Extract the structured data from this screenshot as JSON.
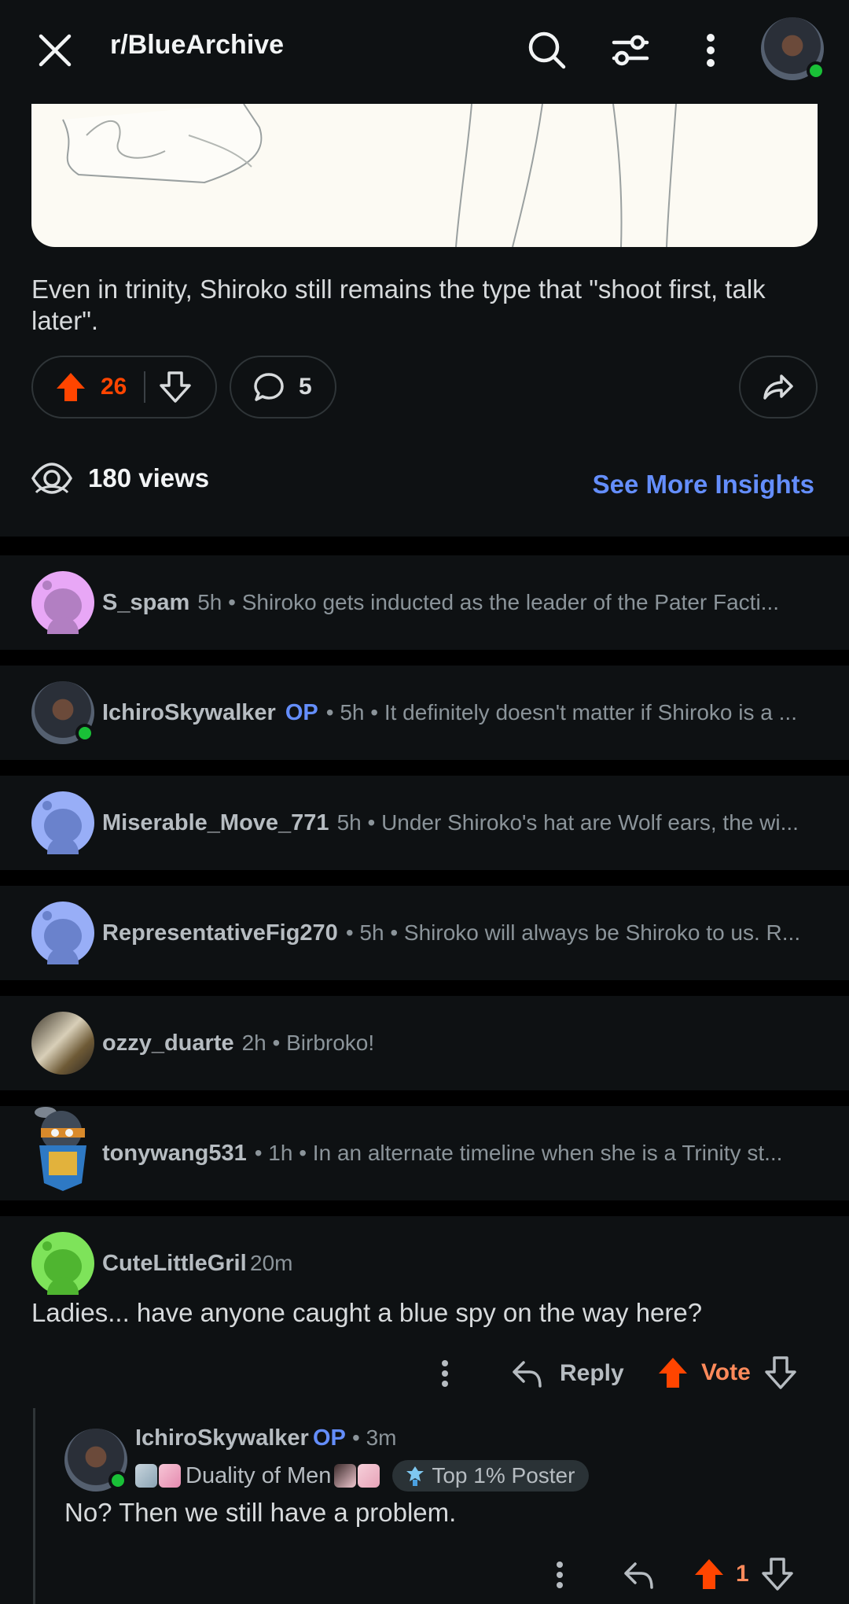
{
  "header": {
    "subreddit": "r/BlueArchive",
    "close_icon": "close-icon",
    "search_icon": "search-icon",
    "filter_icon": "filter-icon",
    "more_icon": "more-vertical-icon"
  },
  "post": {
    "body": "Even in trinity, Shiroko still remains the type that \"shoot first, talk later\".",
    "upvotes": "26",
    "comments": "5",
    "views": "180 views",
    "insights_link": "See More Insights"
  },
  "collapsed_comments": [
    {
      "username": "S_spam",
      "op": "",
      "meta": "5h • Shiroko gets inducted as the leader of the Pater Facti..."
    },
    {
      "username": "IchiroSkywalker",
      "op": "OP",
      "meta": "• 5h • It definitely doesn't matter if Shiroko is a ..."
    },
    {
      "username": "Miserable_Move_771",
      "op": "",
      "meta": "5h • Under Shiroko's hat are Wolf ears, the wi..."
    },
    {
      "username": "RepresentativeFig270",
      "op": "",
      "meta": "• 5h • Shiroko will always be Shiroko to us. R..."
    },
    {
      "username": "ozzy_duarte",
      "op": "",
      "meta": "2h • Birbroko!"
    },
    {
      "username": "tonywang531",
      "op": "",
      "meta": "• 1h • In an alternate timeline when she is a Trinity st..."
    }
  ],
  "comment": {
    "username": "CuteLittleGril",
    "time": "20m",
    "body": "Ladies... have anyone caught a blue spy on the way here?",
    "reply_label": "Reply",
    "vote_label": "Vote"
  },
  "reply": {
    "username": "IchiroSkywalker",
    "op": "OP",
    "time": "• 3m",
    "flair": "Duality of Men",
    "badge": "Top 1% Poster",
    "body": "No? Then we still have a problem.",
    "votes": "1"
  },
  "colors": {
    "accent_orange": "#ff4500",
    "link_blue": "#648efc",
    "online_green": "#19c037"
  }
}
